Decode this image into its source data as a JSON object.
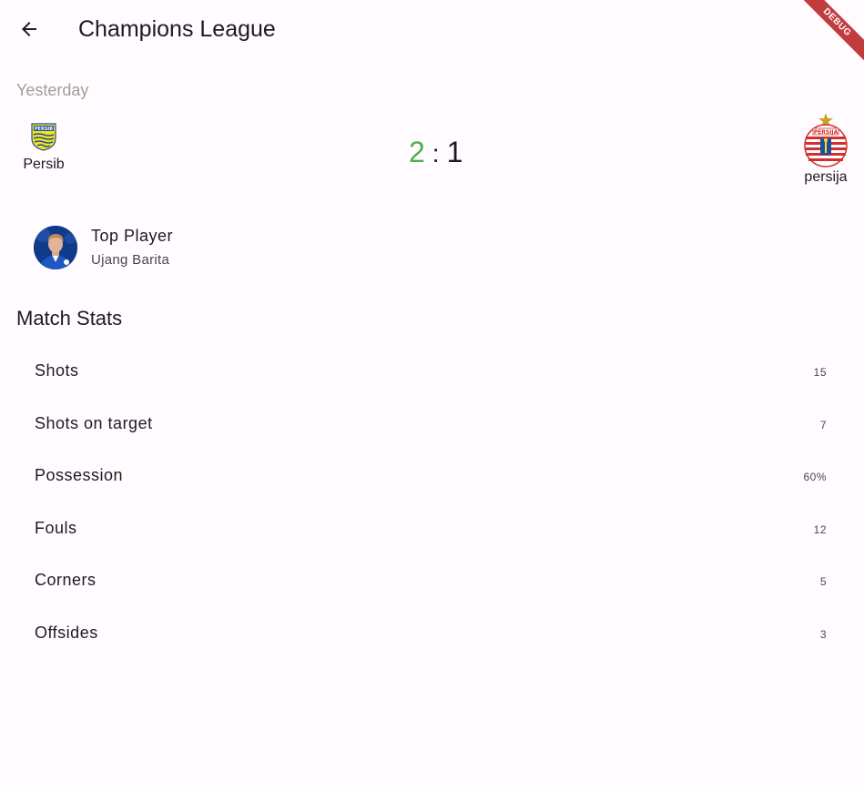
{
  "appbar": {
    "title": "Champions League",
    "back_icon": "arrow-back-icon"
  },
  "debug_banner": "DEBUG",
  "match": {
    "date": "Yesterday",
    "home": {
      "name": "Persib",
      "score": "2",
      "logo": "persib-logo"
    },
    "separator": ":",
    "away": {
      "name": "persija",
      "score": "1",
      "logo": "persija-logo"
    },
    "score_colors": {
      "home": "#4caf50",
      "away": "#1c1b1f"
    }
  },
  "top_player": {
    "title": "Top Player",
    "name": "Ujang Barita"
  },
  "stats": {
    "title": "Match Stats",
    "items": [
      {
        "label": "Shots",
        "value": "15"
      },
      {
        "label": "Shots on target",
        "value": "7"
      },
      {
        "label": "Possession",
        "value": "60%"
      },
      {
        "label": "Fouls",
        "value": "12"
      },
      {
        "label": "Corners",
        "value": "5"
      },
      {
        "label": "Offsides",
        "value": "3"
      }
    ]
  }
}
